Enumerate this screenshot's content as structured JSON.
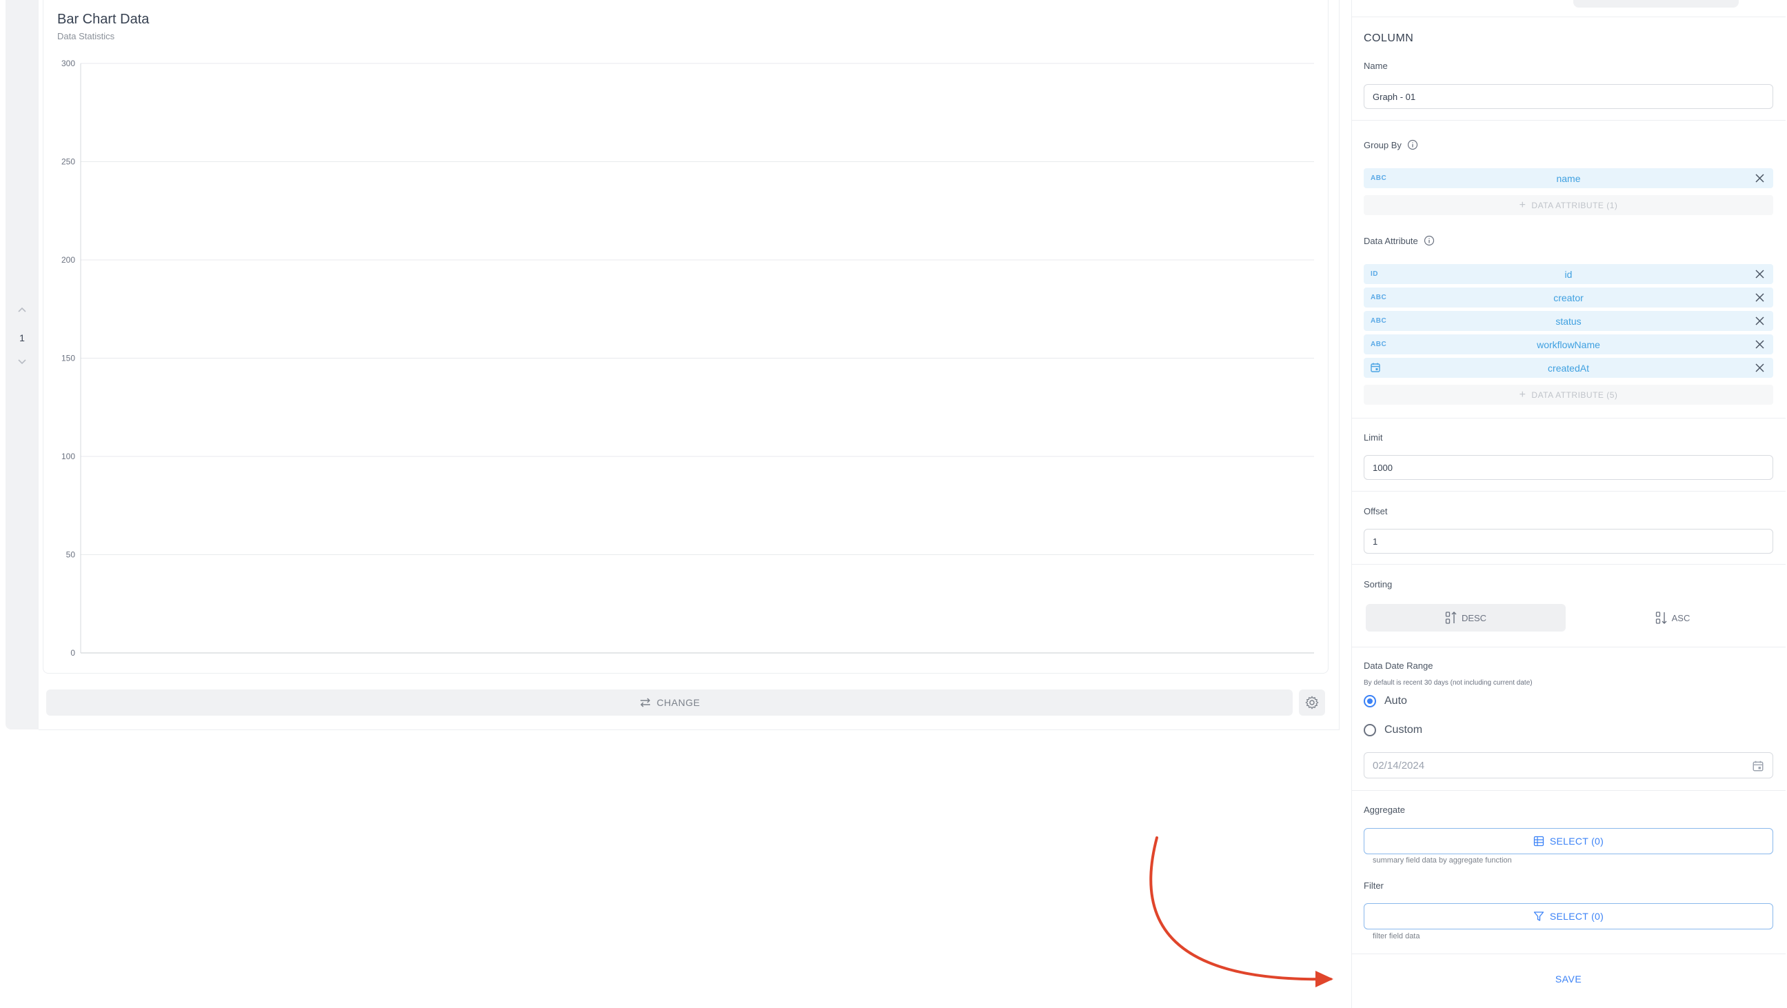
{
  "sidebar": {
    "page_number": "1"
  },
  "chart": {
    "title": "Bar Chart Data",
    "subtitle": "Data Statistics",
    "change_label": "CHANGE"
  },
  "chart_data": {
    "type": "bar",
    "title": "Bar Chart Data",
    "subtitle": "Data Statistics",
    "categories": [],
    "values": [],
    "ylim": [
      0,
      300
    ],
    "yticks": [
      0,
      50,
      100,
      150,
      200,
      250,
      300
    ],
    "xlabel": "",
    "ylabel": "",
    "grid": true
  },
  "panel": {
    "section_title": "COLUMN",
    "name_label": "Name",
    "name_value": "Graph - 01",
    "group_by_label": "Group By",
    "group_by_items": [
      {
        "type": "ABC",
        "name": "name"
      }
    ],
    "group_by_add": "DATA ATTRIBUTE (1)",
    "data_attr_label": "Data Attribute",
    "data_attr_items": [
      {
        "type": "ID",
        "name": "id"
      },
      {
        "type": "ABC",
        "name": "creator"
      },
      {
        "type": "ABC",
        "name": "status"
      },
      {
        "type": "ABC",
        "name": "workflowName"
      },
      {
        "type": "",
        "name": "createdAt",
        "icon": "calendar-icon"
      }
    ],
    "data_attr_add": "DATA ATTRIBUTE (5)",
    "limit_label": "Limit",
    "limit_value": "1000",
    "offset_label": "Offset",
    "offset_value": "1",
    "sorting_label": "Sorting",
    "sort_desc": "DESC",
    "sort_asc": "ASC",
    "date_range_label": "Data Date Range",
    "date_range_hint": "By default is recent 30 days (not including current date)",
    "radio_auto": "Auto",
    "radio_custom": "Custom",
    "date_placeholder": "02/14/2024",
    "aggregate_label": "Aggregate",
    "aggregate_button": "SELECT (0)",
    "aggregate_hint": "summary field data by aggregate function",
    "filter_label": "Filter",
    "filter_button": "SELECT (0)",
    "filter_hint": "filter field data",
    "save_label": "SAVE"
  },
  "colors": {
    "accent": "#3b82f6",
    "chip_bg": "#e8f4fc",
    "chip_text": "#3fa0e0",
    "annotation_arrow": "#e0452b"
  }
}
